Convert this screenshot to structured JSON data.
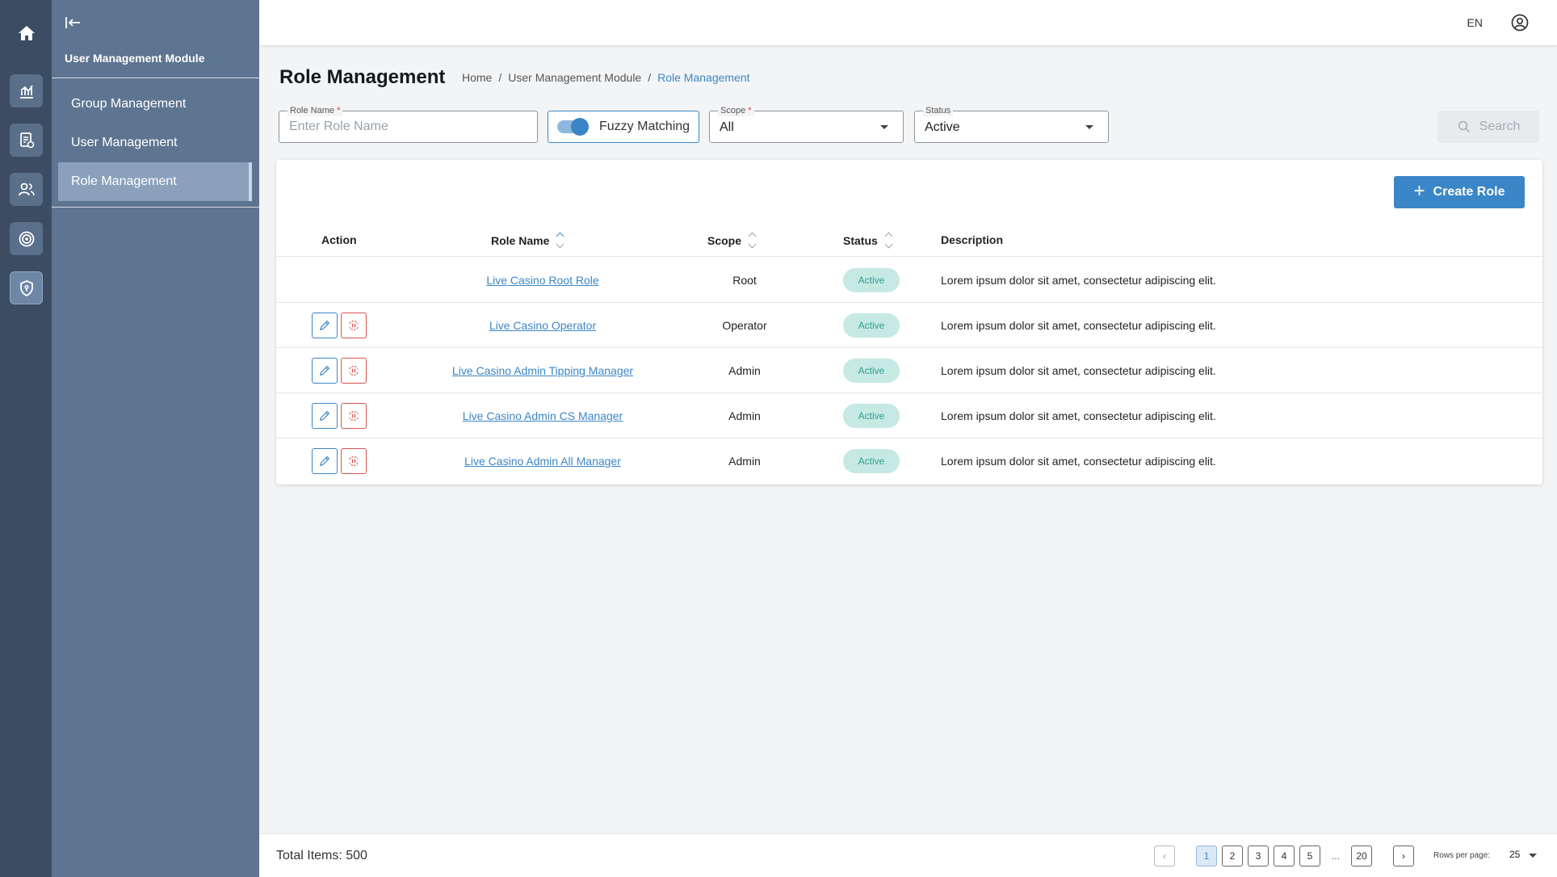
{
  "rail": {
    "items": [
      {
        "name": "home-icon"
      },
      {
        "name": "chart-icon"
      },
      {
        "name": "report-icon"
      },
      {
        "name": "users-icon"
      },
      {
        "name": "target-icon"
      },
      {
        "name": "shield-icon"
      }
    ]
  },
  "sidebar": {
    "module_title": "User Management Module",
    "items": [
      {
        "label": "Group Management"
      },
      {
        "label": "User Management"
      },
      {
        "label": "Role Management"
      }
    ]
  },
  "topbar": {
    "language": "EN"
  },
  "header": {
    "title": "Role Management",
    "breadcrumb": [
      "Home",
      "User Management Module",
      "Role Management"
    ],
    "separator": "/"
  },
  "filters": {
    "role_name": {
      "label": "Role Name",
      "required_mark": "*",
      "placeholder": "Enter Role Name",
      "value": ""
    },
    "fuzzy": {
      "label": "Fuzzy Matching",
      "enabled": true
    },
    "scope": {
      "label": "Scope",
      "required_mark": "*",
      "value": "All"
    },
    "status": {
      "label": "Status",
      "value": "Active"
    },
    "search_label": "Search"
  },
  "table": {
    "create_label": "Create Role",
    "columns": {
      "action": "Action",
      "role_name": "Role Name",
      "scope": "Scope",
      "status": "Status",
      "description": "Description"
    },
    "rows": [
      {
        "name": "Live Casino Root Role",
        "scope": "Root",
        "status": "Active",
        "description": "Lorem ipsum dolor sit amet, consectetur adipiscing elit.",
        "has_actions": false
      },
      {
        "name": "Live Casino Operator",
        "scope": "Operator",
        "status": "Active",
        "description": "Lorem ipsum dolor sit amet, consectetur adipiscing elit.",
        "has_actions": true
      },
      {
        "name": "Live Casino Admin Tipping Manager",
        "scope": "Admin",
        "status": "Active",
        "description": "Lorem ipsum dolor sit amet, consectetur adipiscing elit.",
        "has_actions": true
      },
      {
        "name": "Live Casino Admin CS Manager",
        "scope": "Admin",
        "status": "Active",
        "description": "Lorem ipsum dolor sit amet, consectetur adipiscing elit.",
        "has_actions": true
      },
      {
        "name": "Live Casino Admin All Manager",
        "scope": "Admin",
        "status": "Active",
        "description": "Lorem ipsum dolor sit amet, consectetur adipiscing elit.",
        "has_actions": true
      }
    ]
  },
  "footer": {
    "total": "Total Items: 500",
    "pages": [
      "1",
      "2",
      "3",
      "4",
      "5"
    ],
    "ellipsis": "...",
    "last_page": "20",
    "current_page": "1",
    "rows_per_page_label": "Rows per page:",
    "rows_per_page": "25"
  },
  "colors": {
    "accent": "#3b86c6",
    "rail": "#3c4d63",
    "sidebar": "#5e7591",
    "status_bg": "#c6e9e4",
    "status_text": "#2e9e8f",
    "danger": "#d9534f"
  }
}
